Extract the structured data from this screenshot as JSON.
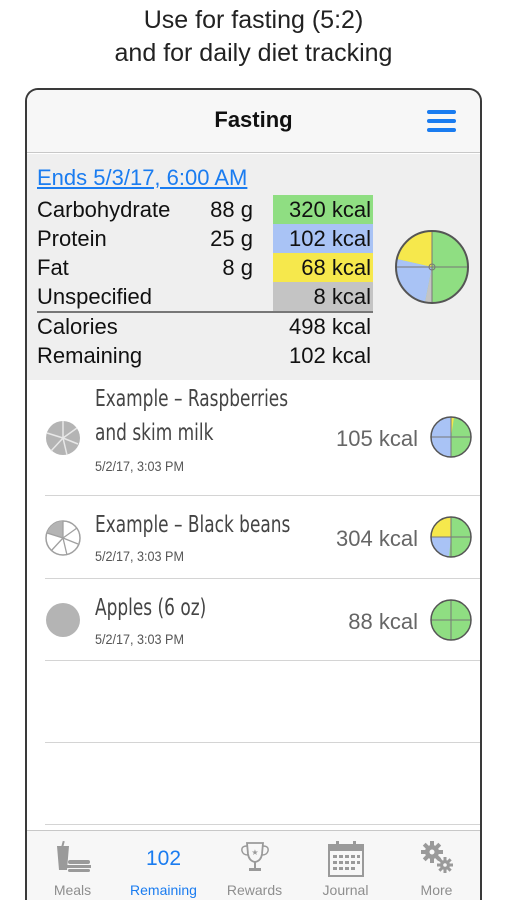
{
  "caption": {
    "line1": "Use for fasting (5:2)",
    "line2": "and for daily diet tracking"
  },
  "navbar": {
    "title": "Fasting",
    "menu_icon": "hamburger-menu-icon"
  },
  "summary": {
    "ends": "Ends 5/3/17, 6:00 AM",
    "nutrients": [
      {
        "label": "Carbohydrate",
        "grams": "88 g",
        "kcal": "320 kcal",
        "color": "#8fde82"
      },
      {
        "label": "Protein",
        "grams": "25 g",
        "kcal": "102 kcal",
        "color": "#a9c3f5"
      },
      {
        "label": "Fat",
        "grams": "8 g",
        "kcal": "68 kcal",
        "color": "#f6e84c"
      },
      {
        "label": "Unspecified",
        "grams": "",
        "kcal": "8 kcal",
        "color": "#c4c4c4"
      }
    ],
    "calories_label": "Calories",
    "calories_value": "498 kcal",
    "remaining_label": "Remaining",
    "remaining_value": "102 kcal"
  },
  "meals": [
    {
      "name_line1": "Example – Raspberries",
      "name_line2": "and skim milk",
      "date": "5/2/17, 3:03 PM",
      "kcal": "105 kcal",
      "icon": "pie-slices-gray-icon"
    },
    {
      "name_line1": "Example – Black beans",
      "name_line2": "",
      "date": "5/2/17, 3:03 PM",
      "kcal": "304 kcal",
      "icon": "pie-slices-outline-icon"
    },
    {
      "name_line1": "Apples (6 oz)",
      "name_line2": "",
      "date": "5/2/17, 3:03 PM",
      "kcal": "88 kcal",
      "icon": "solid-circle-icon"
    }
  ],
  "tabs": [
    {
      "label": "Meals",
      "icon": "meals-icon",
      "active": false
    },
    {
      "label": "Remaining",
      "value": "102",
      "active": true
    },
    {
      "label": "Rewards",
      "icon": "trophy-icon",
      "active": false
    },
    {
      "label": "Journal",
      "icon": "calendar-icon",
      "active": false
    },
    {
      "label": "More",
      "icon": "gears-icon",
      "active": false
    }
  ]
}
